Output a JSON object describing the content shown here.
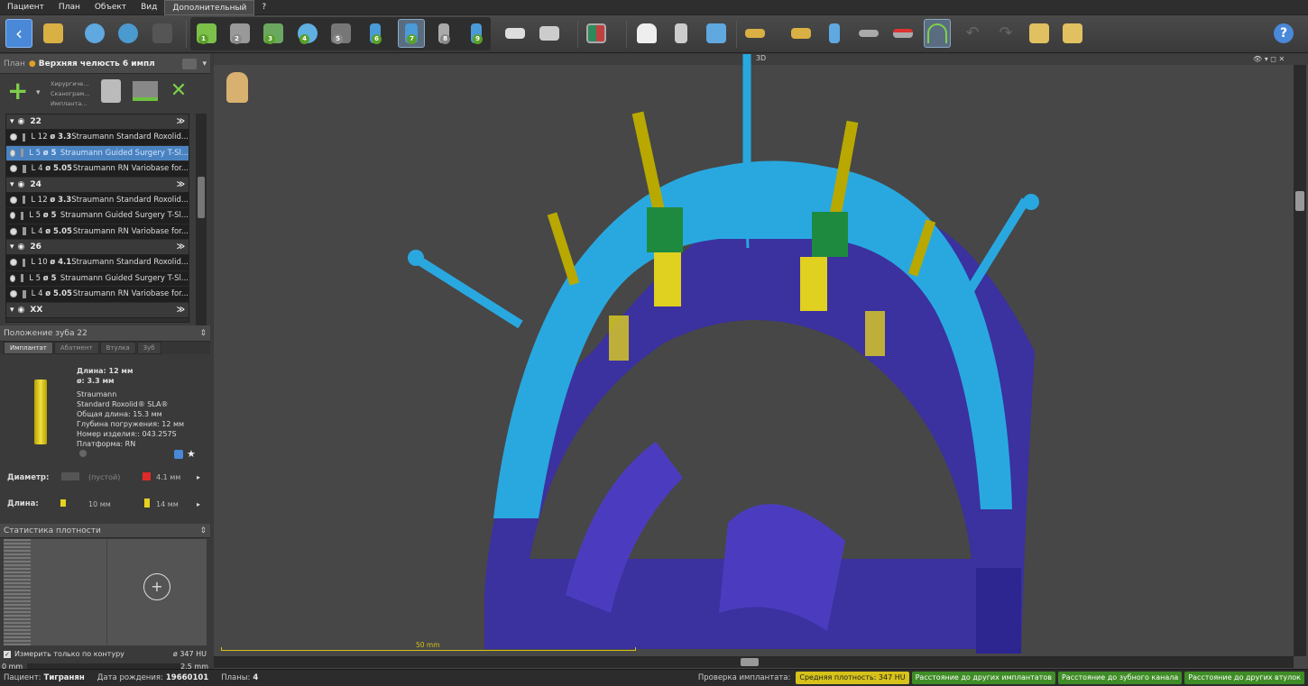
{
  "menu": [
    "Пациент",
    "План",
    "Объект",
    "Вид",
    "Дополнительный",
    "?"
  ],
  "active_menu": "Дополнительный",
  "toolbar": {
    "icons": [
      "back-icon",
      "open-folder-icon",
      "link-icon",
      "globe-scan-icon",
      "disabled-icon",
      "step-1-icon",
      "step-2-icon",
      "step-3-icon",
      "step-4-icon",
      "step-5-icon",
      "step-6-icon",
      "step-7-icon",
      "step-8-icon",
      "step-9-icon",
      "guide-icon",
      "print-icon",
      "layout-icon",
      "tooth-icon",
      "implant-place-icon",
      "box-icon",
      "sleeve-icon",
      "abutment-icon",
      "implant-blue-icon",
      "measure-icon",
      "delete-measure-icon",
      "arch-view-icon",
      "undo-icon",
      "redo-icon",
      "export-folder-icon",
      "import-folder-icon",
      "help-icon"
    ],
    "step_numbers": [
      "1",
      "2",
      "3",
      "4",
      "5",
      "6",
      "7",
      "8",
      "9"
    ]
  },
  "plan": {
    "label": "План",
    "name": "Верхняя челюсть 6 импл",
    "sub_labels": [
      "Хирургиче...",
      "Сканограм...",
      "Имплантa..."
    ]
  },
  "tree": [
    {
      "group": "22",
      "rows": [
        {
          "dims": [
            "L 12",
            "ø 3.3"
          ],
          "name": "Straumann Standard Roxolid..."
        },
        {
          "dims": [
            "L 5",
            "ø 5"
          ],
          "name": "Straumann Guided Surgery T-Sl..."
        },
        {
          "dims": [
            "L 4",
            "ø 5.05"
          ],
          "name": "Straumann RN Variobase for..."
        }
      ]
    },
    {
      "group": "24",
      "rows": [
        {
          "dims": [
            "L 12",
            "ø 3.3"
          ],
          "name": "Straumann Standard Roxolid..."
        },
        {
          "dims": [
            "L 5",
            "ø 5"
          ],
          "name": "Straumann Guided Surgery T-Sl..."
        },
        {
          "dims": [
            "L 4",
            "ø 5.05"
          ],
          "name": "Straumann RN Variobase for..."
        }
      ]
    },
    {
      "group": "26",
      "rows": [
        {
          "dims": [
            "L 10",
            "ø 4.1"
          ],
          "name": "Straumann Standard Roxolid..."
        },
        {
          "dims": [
            "L 5",
            "ø 5"
          ],
          "name": "Straumann Guided Surgery T-Sl..."
        },
        {
          "dims": [
            "L 4",
            "ø 5.05"
          ],
          "name": "Straumann RN Variobase for..."
        }
      ]
    },
    {
      "group": "XX",
      "rows": []
    }
  ],
  "position_panel": {
    "title": "Положение зуба 22",
    "tabs": [
      "Имплантат",
      "Абатмент",
      "Втулка",
      "Зуб"
    ],
    "length": "Длина: 12 мм",
    "diameter": "ø: 3.3 мм",
    "details": [
      "Straumann",
      "Standard Roxolid® SLA®",
      "Общая длина: 15.3 мм",
      "Глубина погружения: 12 мм",
      "Номер изделия:: 043.257S",
      "Платформа: RN"
    ],
    "diam_label": "Диаметр:",
    "diam_opts": [
      "(пустой)",
      "4.1 мм"
    ],
    "len_label": "Длина:",
    "len_opts": [
      "10 мм",
      "14 мм"
    ]
  },
  "density": {
    "title": "Статистика плотности",
    "checkbox": "Измерить только по контуру",
    "hu": "ø 347 HU",
    "range_min": "0 mm",
    "range_max": "2.5 mm"
  },
  "view": {
    "title": "3D",
    "scale": "50 mm"
  },
  "status": {
    "patient_label": "Пациент:",
    "patient": "Тигранян",
    "dob_label": "Дата рождения:",
    "dob": "19660101",
    "plans_label": "Планы:",
    "plans": "4",
    "check_label": "Проверка имплантата:",
    "badges": [
      {
        "text": "Средняя плотность: 347 HU",
        "color": "#d6c21a"
      },
      {
        "text": "Расстояние до других имплантатов",
        "color": "#3f8d26"
      },
      {
        "text": "Расстояние до зубного канала",
        "color": "#3f8d26"
      },
      {
        "text": "Расстояние до других втулок",
        "color": "#3f8d26"
      }
    ]
  }
}
